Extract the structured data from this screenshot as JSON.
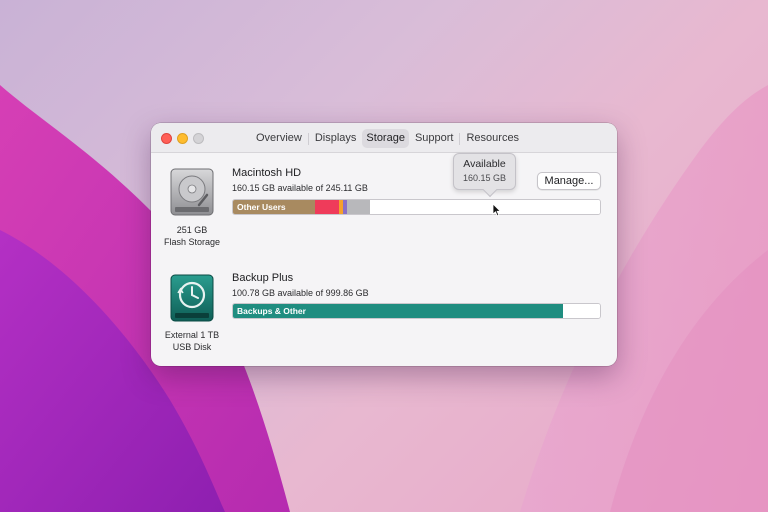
{
  "window": {
    "tabs": [
      {
        "label": "Overview",
        "active": false
      },
      {
        "label": "Displays",
        "active": false
      },
      {
        "label": "Storage",
        "active": true
      },
      {
        "label": "Support",
        "active": false
      },
      {
        "label": "Resources",
        "active": false
      }
    ]
  },
  "volumes": [
    {
      "name": "Macintosh HD",
      "available_text": "160.15 GB available of 245.11 GB",
      "caption_line1": "251 GB",
      "caption_line2": "Flash Storage",
      "icon": "hard-drive-icon",
      "manage_label": "Manage...",
      "segments": [
        {
          "label": "Other Users",
          "fraction": 0.224,
          "color": "#a88a60"
        },
        {
          "label": "",
          "fraction": 0.066,
          "color": "#ef3b5a"
        },
        {
          "label": "",
          "fraction": 0.008,
          "color": "#f5a02c"
        },
        {
          "label": "",
          "fraction": 0.011,
          "color": "#8a6fc6"
        },
        {
          "label": "",
          "fraction": 0.062,
          "color": "#b8b8bb"
        }
      ],
      "tooltip": {
        "title": "Available",
        "value": "160.15 GB"
      }
    },
    {
      "name": "Backup Plus",
      "available_text": "100.78 GB available of 999.86 GB",
      "caption_line1": "External 1 TB",
      "caption_line2": "USB Disk",
      "icon": "time-machine-icon",
      "segments": [
        {
          "label": "Backups & Other",
          "fraction": 0.899,
          "color": "#1f8d80"
        }
      ]
    }
  ],
  "colors": {
    "close": "#ff5f57",
    "minimize": "#febc2e",
    "zoom": "#d4d3d6"
  }
}
